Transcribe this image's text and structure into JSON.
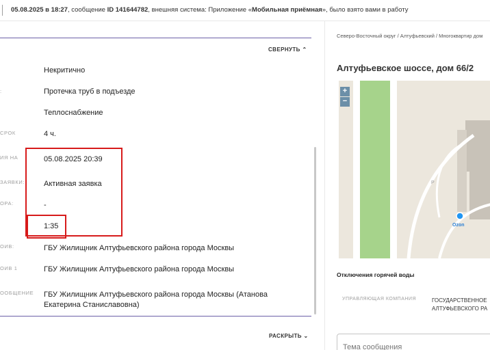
{
  "topbar": {
    "date": "05.08.2025 в 18:27",
    "text1": ", сообщение ",
    "msg_id": "ID 141644782",
    "text2": ", внешняя система: Приложение «",
    "system": "Мобильная приёмная",
    "text3": "», было взято вами в работу"
  },
  "details": {
    "collapse_label": "СВЕРНУТЬ ⌃",
    "expand_label": "РАСКРЫТЬ ⌄",
    "fields": [
      {
        "label": "",
        "value": "Некритично"
      },
      {
        "label": ":",
        "value": "Протечка труб в подъезде"
      },
      {
        "label": "",
        "value": "Теплоснабжение"
      },
      {
        "label": "СРОК",
        "value": "4 ч."
      },
      {
        "label": "ИЯ НА",
        "value": "05.08.2025 20:39"
      },
      {
        "label": "ЗАЯВКИ:",
        "value": "Активная заявка"
      },
      {
        "label": "ОРА:",
        "value": "-"
      },
      {
        "label": "",
        "value": "1:35"
      },
      {
        "label": "ОИВ:",
        "value": "ГБУ Жилищник Алтуфьевского района города Москвы"
      },
      {
        "label": "ОИВ 1",
        "value": "ГБУ Жилищник Алтуфьевского района города Москвы"
      },
      {
        "label": "ООБЩЕНИЕ",
        "value": "ГБУ Жилищник Алтуфьевского района города Москвы (Атанова Екатерина Станиславовна)"
      }
    ]
  },
  "right": {
    "breadcrumb": "Северо-Восточный округ / Алтуфьевский / Многоквартир дом",
    "address": "Алтуфьевское шоссе, дом 66/2",
    "map": {
      "zoom_in": "+",
      "zoom_out": "−",
      "poi_label": "Ozon",
      "parking_label": "P",
      "colors": {
        "park": "#a6d38b",
        "road": "#ffffff",
        "building": "#c8c2b8",
        "poi": "#2196f3"
      }
    },
    "hot_water_title": "Отключения горячей воды",
    "company_header": "УПРАВЛЯЮЩАЯ КОМПАНИЯ",
    "company_value": "ГОСУДАРСТВЕННОЕ АЛТУФЬЕВСКОГО РА",
    "subject_placeholder": "Тема сообщения"
  },
  "colors": {
    "highlight": "#d71a1a",
    "divider_accent": "#6b5fa6"
  }
}
